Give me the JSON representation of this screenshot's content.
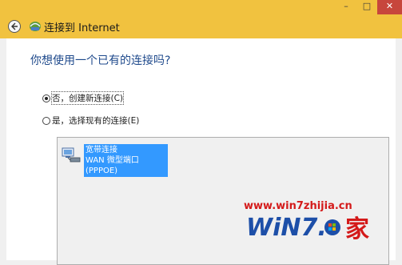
{
  "window": {
    "minimize_glyph": "–",
    "maximize_glyph": "□",
    "close_glyph": "✕"
  },
  "header": {
    "title": "连接到 Internet"
  },
  "main": {
    "question": "你想使用一个已有的连接吗?",
    "options": [
      {
        "label": "否，创建新连接(C)",
        "selected": true
      },
      {
        "label": "是，选择现有的连接(E)",
        "selected": false
      }
    ],
    "connections": [
      {
        "name": "宽带连接",
        "type": "WAN 微型端口(PPPOE)"
      }
    ]
  },
  "watermark": {
    "url": "www.win7zhijia.cn",
    "logo_text": "WiN7.家"
  },
  "colors": {
    "title_bar": "#f1c23f",
    "question_text": "#1f4a8c",
    "selection": "#3399ff",
    "close_button": "#c7463c",
    "watermark_red": "#d41a1a"
  }
}
